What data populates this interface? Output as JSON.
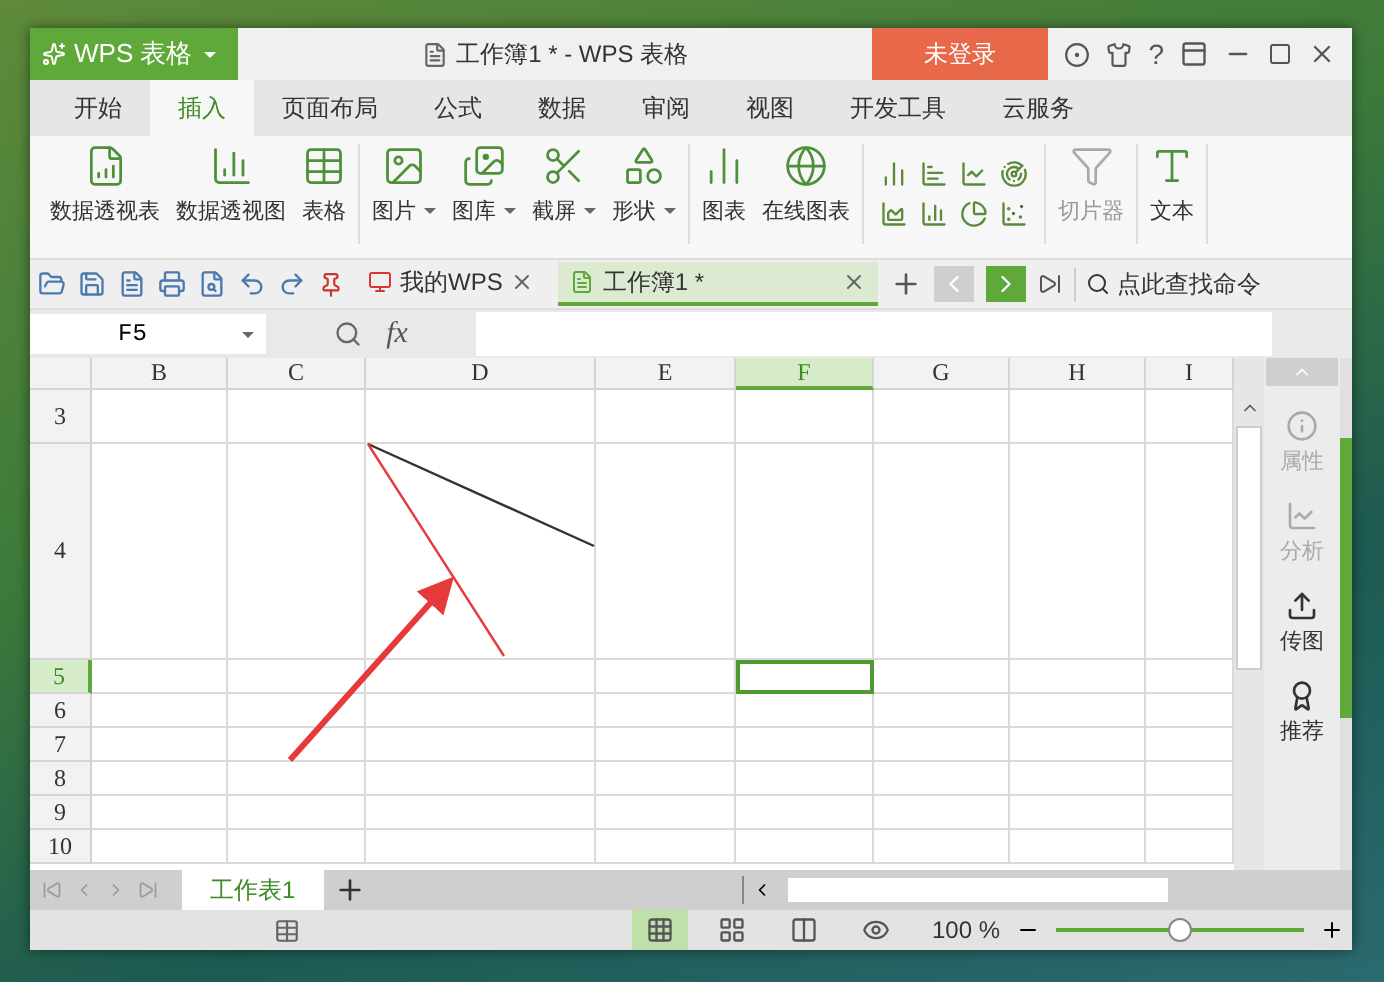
{
  "title_bar": {
    "app_name": "WPS 表格",
    "document_title": "工作簿1 * - WPS 表格",
    "login_button": "未登录",
    "help_label": "?"
  },
  "menu_tabs": [
    {
      "label": "开始",
      "selected": false
    },
    {
      "label": "插入",
      "selected": true
    },
    {
      "label": "页面布局",
      "selected": false
    },
    {
      "label": "公式",
      "selected": false
    },
    {
      "label": "数据",
      "selected": false
    },
    {
      "label": "审阅",
      "selected": false
    },
    {
      "label": "视图",
      "selected": false
    },
    {
      "label": "开发工具",
      "selected": false
    },
    {
      "label": "云服务",
      "selected": false
    }
  ],
  "ribbon": {
    "groups": [
      {
        "items": [
          {
            "label": "数据透视表",
            "kind": "pivot-table",
            "dropdown": false
          },
          {
            "label": "数据透视图",
            "kind": "pivot-chart",
            "dropdown": false
          },
          {
            "label": "表格",
            "kind": "table",
            "dropdown": false
          }
        ]
      },
      {
        "items": [
          {
            "label": "图片",
            "kind": "picture",
            "dropdown": true
          },
          {
            "label": "图库",
            "kind": "gallery",
            "dropdown": true
          },
          {
            "label": "截屏",
            "kind": "screenshot",
            "dropdown": true
          },
          {
            "label": "形状",
            "kind": "shapes",
            "dropdown": true
          }
        ]
      },
      {
        "items": [
          {
            "label": "图表",
            "kind": "chart",
            "dropdown": false
          },
          {
            "label": "在线图表",
            "kind": "online-chart",
            "dropdown": false
          }
        ]
      },
      {
        "items": [
          {
            "label": "切片器",
            "kind": "slicer",
            "dropdown": false,
            "disabled": true
          }
        ]
      },
      {
        "items": [
          {
            "label": "文本",
            "kind": "text",
            "dropdown": false,
            "disabled": false
          }
        ]
      }
    ]
  },
  "quick_toolbar": {
    "tabs": [
      {
        "label": "我的WPS",
        "kind": "wps",
        "selected": false
      },
      {
        "label": "工作簿1 *",
        "kind": "sheet",
        "selected": true
      }
    ],
    "search": "点此查找命令"
  },
  "formula_bar": {
    "cell_reference": "F5",
    "function_label": "fx"
  },
  "sheet": {
    "columns": [
      {
        "label": "B",
        "selected": false
      },
      {
        "label": "C",
        "selected": false
      },
      {
        "label": "D",
        "selected": false
      },
      {
        "label": "E",
        "selected": false
      },
      {
        "label": "F",
        "selected": true
      },
      {
        "label": "G",
        "selected": false
      },
      {
        "label": "H",
        "selected": false
      },
      {
        "label": "I",
        "selected": false
      }
    ],
    "rows": [
      {
        "label": "3",
        "selected": false
      },
      {
        "label": "4",
        "selected": false
      },
      {
        "label": "5",
        "selected": true
      },
      {
        "label": "6",
        "selected": false
      },
      {
        "label": "7",
        "selected": false
      },
      {
        "label": "8",
        "selected": false
      },
      {
        "label": "9",
        "selected": false
      },
      {
        "label": "10",
        "selected": false
      }
    ]
  },
  "side_pane": {
    "items": [
      {
        "label": "属性",
        "kind": "properties",
        "disabled": true
      },
      {
        "label": "分析",
        "kind": "analysis",
        "disabled": true
      },
      {
        "label": "传图",
        "kind": "upload",
        "disabled": false
      },
      {
        "label": "推荐",
        "kind": "recommend",
        "disabled": false
      }
    ]
  },
  "sheet_tabs": [
    {
      "label": "工作表1",
      "selected": true
    }
  ],
  "status_bar": {
    "view_modes": [
      {
        "kind": "normal",
        "selected": true
      },
      {
        "kind": "page-break",
        "selected": false
      },
      {
        "kind": "reading",
        "selected": false
      },
      {
        "kind": "eye",
        "selected": false
      }
    ],
    "zoom": "100 %",
    "zoom_slider": {
      "level": 0.5
    }
  }
}
